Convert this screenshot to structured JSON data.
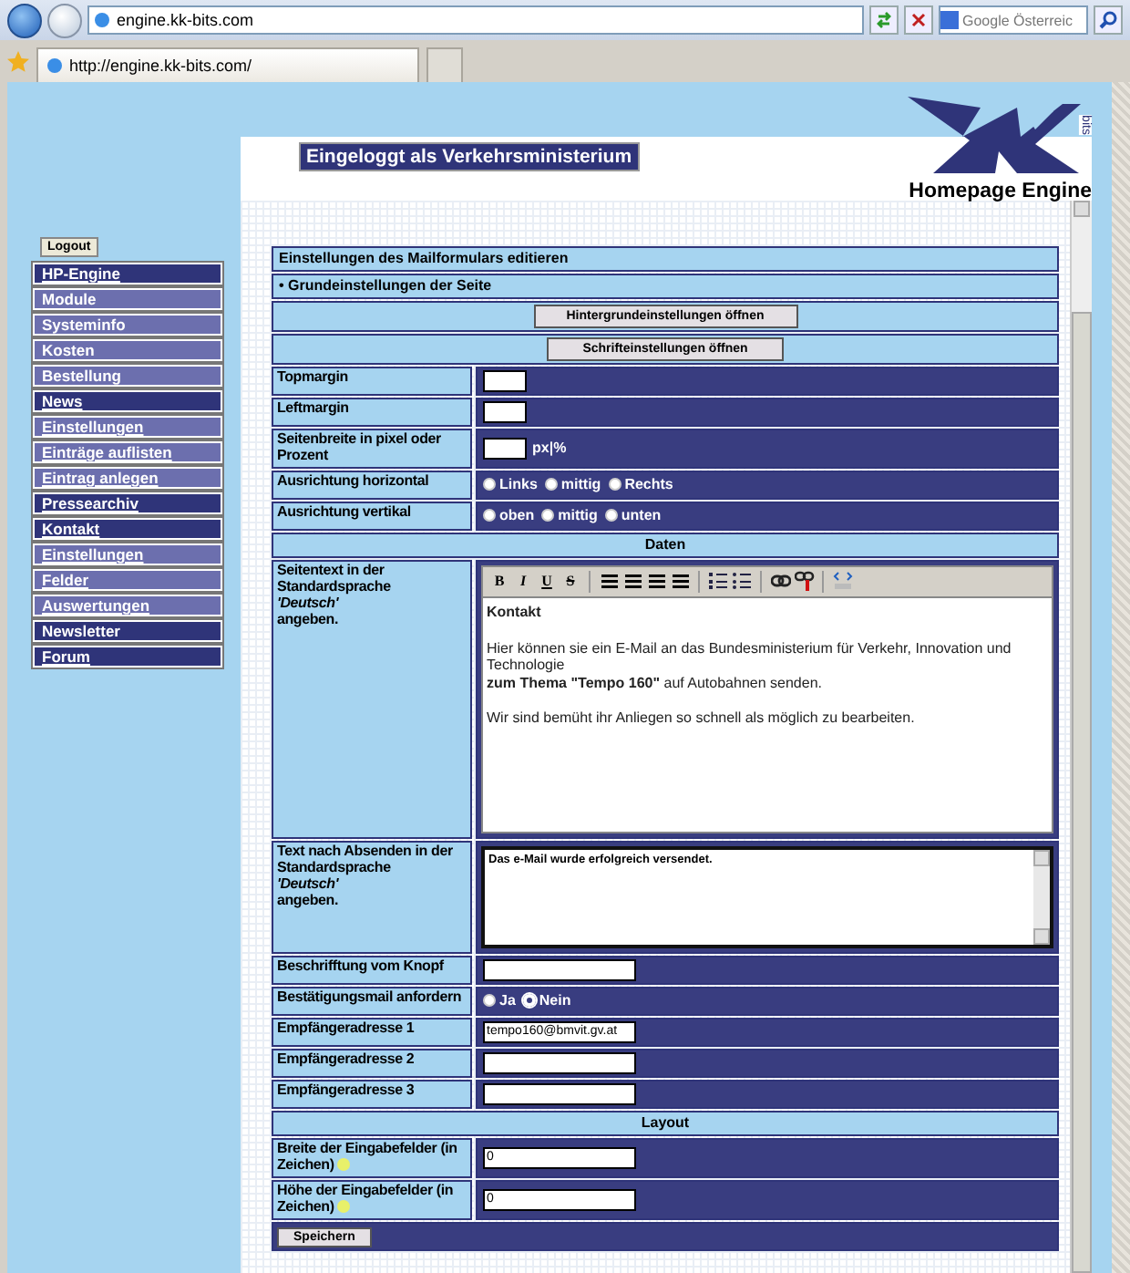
{
  "browser": {
    "address": "engine.kk-bits.com",
    "search_placeholder": "Google Österreic",
    "tab": "http://engine.kk-bits.com/"
  },
  "header": {
    "logged_in": "Eingeloggt als Verkehrsministerium",
    "logo_small": "bits",
    "logo_title": "Homepage Engine"
  },
  "sidebar": {
    "logout": "Logout",
    "items": [
      {
        "label": "HP-Engine",
        "kind": "main",
        "link": true
      },
      {
        "label": "Module",
        "kind": "sub",
        "link": false
      },
      {
        "label": "Systeminfo",
        "kind": "sub",
        "link": false
      },
      {
        "label": "Kosten",
        "kind": "sub",
        "link": false
      },
      {
        "label": "Bestellung",
        "kind": "sub",
        "link": false
      },
      {
        "label": "News",
        "kind": "main",
        "link": true
      },
      {
        "label": "Einstellungen",
        "kind": "sub",
        "link": true
      },
      {
        "label": "Einträge auflisten",
        "kind": "sub",
        "link": true
      },
      {
        "label": "Eintrag anlegen",
        "kind": "sub",
        "link": true
      },
      {
        "label": "Pressearchiv",
        "kind": "main",
        "link": true
      },
      {
        "label": "Kontakt",
        "kind": "main",
        "link": true
      },
      {
        "label": "Einstellungen",
        "kind": "sub",
        "link": true
      },
      {
        "label": "Felder",
        "kind": "sub",
        "link": true
      },
      {
        "label": "Auswertungen",
        "kind": "sub",
        "link": true
      },
      {
        "label": "Newsletter",
        "kind": "main",
        "link": false
      },
      {
        "label": "Forum",
        "kind": "main",
        "link": true
      }
    ]
  },
  "form": {
    "rows": [
      {
        "kind": "header",
        "text": "Einstellungen des Mailformulars editieren"
      },
      {
        "kind": "header",
        "text": "• Grundeinstellungen der Seite"
      },
      {
        "kind": "button",
        "text": "Hintergrundeinstellungen öffnen"
      },
      {
        "kind": "button",
        "text": "Schrifteinstellungen öffnen"
      },
      {
        "kind": "input",
        "label": "Topmargin",
        "wide": false
      },
      {
        "kind": "input",
        "label": "Leftmargin",
        "wide": false
      },
      {
        "kind": "input",
        "label": "Seitenbreite in pixel oder Prozent",
        "wide": false,
        "suffix": "px|%"
      },
      {
        "kind": "radio",
        "label": "Ausrichtung horizontal",
        "options": [
          {
            "label": "Links",
            "selected": false
          },
          {
            "label": "mittig",
            "selected": false
          },
          {
            "label": "Rechts",
            "selected": false
          }
        ]
      },
      {
        "kind": "radio",
        "label": "Ausrichtung vertikal",
        "options": [
          {
            "label": "oben",
            "selected": false
          },
          {
            "label": "mittig",
            "selected": false
          },
          {
            "label": "unten",
            "selected": false
          }
        ]
      },
      {
        "kind": "section",
        "text": "Daten"
      },
      {
        "kind": "editor",
        "label": "Seitentext in der\nStandardsprache\n*'Deutsch'*\nangeben.",
        "toolbar": [
          "B",
          "I",
          "U",
          "S"
        ],
        "paragraphs": [
          [
            "**Kontakt**"
          ],
          [
            "Hier können sie ein E-Mail an das Bundesministerium für Verkehr, Innovation und Technologie",
            "**zum Thema \"Tempo 160\"** auf Autobahnen senden."
          ],
          [
            "Wir sind bemüht ihr Anliegen so schnell als möglich zu bearbeiten."
          ]
        ]
      },
      {
        "kind": "textarea",
        "label": "Text nach Absenden in der\nStandardsprache\n*'Deutsch'*\nangeben.",
        "value": "Das e-Mail wurde erfolgreich versendet."
      },
      {
        "kind": "input",
        "label": "Beschrifftung vom Knopf",
        "wide": true
      },
      {
        "kind": "radio",
        "label": "Bestätigungsmail anfordern",
        "options": [
          {
            "label": "Ja",
            "selected": false
          },
          {
            "label": "Nein",
            "selected": true
          }
        ]
      },
      {
        "kind": "input",
        "label": "Empfängeradresse 1",
        "wide": true,
        "value": "tempo160@bmvit.gv.at"
      },
      {
        "kind": "input",
        "label": "Empfängeradresse 2",
        "wide": true
      },
      {
        "kind": "input",
        "label": "Empfängeradresse 3",
        "wide": true
      },
      {
        "kind": "section",
        "text": "Layout"
      },
      {
        "kind": "input",
        "label": "Breite der Eingabefelder (in Zeichen)",
        "wide": true,
        "value": "0",
        "info": true
      },
      {
        "kind": "input",
        "label": "Höhe der Eingabefelder (in Zeichen)",
        "wide": true,
        "value": "0",
        "info": true
      },
      {
        "kind": "save",
        "text": "Speichern"
      }
    ]
  }
}
